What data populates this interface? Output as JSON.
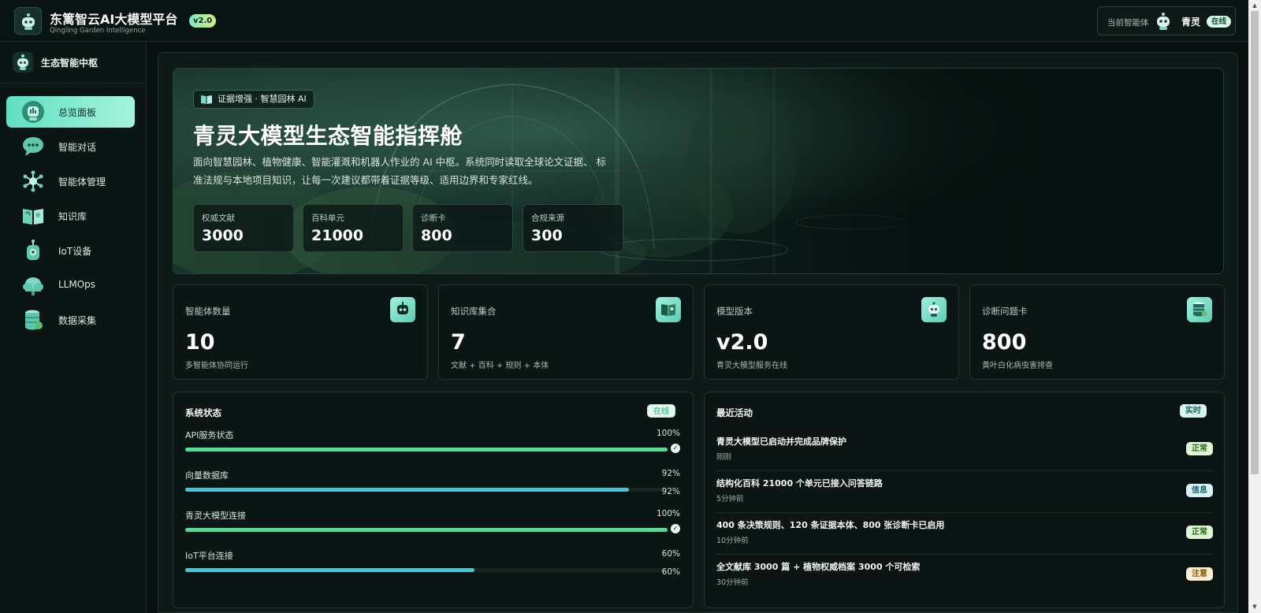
{
  "header": {
    "app_title": "东篱智云AI大模型平台",
    "app_subtitle": "Qingling Garden Intelligence",
    "version_badge": "v2.0",
    "current_agent_label": "当前智能体",
    "current_agent_name": "青灵",
    "current_agent_status": "在线"
  },
  "sidebar": {
    "title": "生态智能中枢",
    "items": [
      {
        "label": "总览面板",
        "icon": "dashboard-robot-icon",
        "active": true
      },
      {
        "label": "智能对话",
        "icon": "chat-bubble-icon",
        "active": false
      },
      {
        "label": "智能体管理",
        "icon": "network-hub-icon",
        "active": false
      },
      {
        "label": "知识库",
        "icon": "open-book-icon",
        "active": false
      },
      {
        "label": "IoT设备",
        "icon": "iot-device-icon",
        "active": false
      },
      {
        "label": "LLMOps",
        "icon": "cloud-ops-icon",
        "active": false
      },
      {
        "label": "数据采集",
        "icon": "database-icon",
        "active": false
      }
    ]
  },
  "hero": {
    "tag": "证据增强 · 智慧园林 AI",
    "title": "青灵大模型生态智能指挥舱",
    "description": "面向智慧园林、植物健康、智能灌溉和机器人作业的 AI 中枢。系统同时读取全球论文证据、 标准法规与本地项目知识，让每一次建议都带着证据等级、适用边界和专家红线。",
    "stats": [
      {
        "label": "权威文献",
        "value": "3000"
      },
      {
        "label": "百科单元",
        "value": "21000"
      },
      {
        "label": "诊断卡",
        "value": "800"
      },
      {
        "label": "合规来源",
        "value": "300"
      }
    ]
  },
  "cards": [
    {
      "label": "智能体数量",
      "value": "10",
      "sub": "多智能体协同运行",
      "icon": "robot-icon"
    },
    {
      "label": "知识库集合",
      "value": "7",
      "sub": "文献 + 百科 + 规则 + 本体",
      "icon": "book-icon"
    },
    {
      "label": "模型版本",
      "value": "v2.0",
      "sub": "青灵大模型服务在线",
      "icon": "bot-avatar-icon"
    },
    {
      "label": "诊断问题卡",
      "value": "800",
      "sub": "黄叶白化病虫害排查",
      "icon": "database-stack-icon"
    }
  ],
  "system_status": {
    "title": "系统状态",
    "badge": "在线",
    "items": [
      {
        "name": "API服务状态",
        "percent_label": "100%",
        "percent": 100,
        "secondary": "",
        "color": "#5fd69b"
      },
      {
        "name": "向量数据库",
        "percent_label": "92%",
        "percent": 92,
        "secondary": "92%",
        "color": "#3fc7df"
      },
      {
        "name": "青灵大模型连接",
        "percent_label": "100%",
        "percent": 100,
        "secondary": "",
        "color": "#5fd69b"
      },
      {
        "name": "IoT平台连接",
        "percent_label": "60%",
        "percent": 60,
        "secondary": "60%",
        "color": "#3fc7df"
      }
    ]
  },
  "activity": {
    "title": "最近活动",
    "badge": "实时",
    "items": [
      {
        "text": "青灵大模型已启动并完成品牌保护",
        "time": "刚刚",
        "status": "正常",
        "status_color": "#dff6d6",
        "status_text_color": "#2c6b1f"
      },
      {
        "text": "结构化百科 21000 个单元已接入问答链路",
        "time": "5分钟前",
        "status": "信息",
        "status_color": "#d9f2f6",
        "status_text_color": "#1b6270"
      },
      {
        "text": "400 条决策规则、120 条证据本体、800 张诊断卡已启用",
        "time": "10分钟前",
        "status": "正常",
        "status_color": "#dff6d6",
        "status_text_color": "#2c6b1f"
      },
      {
        "text": "全文献库 3000 篇 + 植物权威档案 3000 个可检索",
        "time": "30分钟前",
        "status": "注意",
        "status_color": "#fbefd1",
        "status_text_color": "#8a5a08"
      }
    ]
  }
}
